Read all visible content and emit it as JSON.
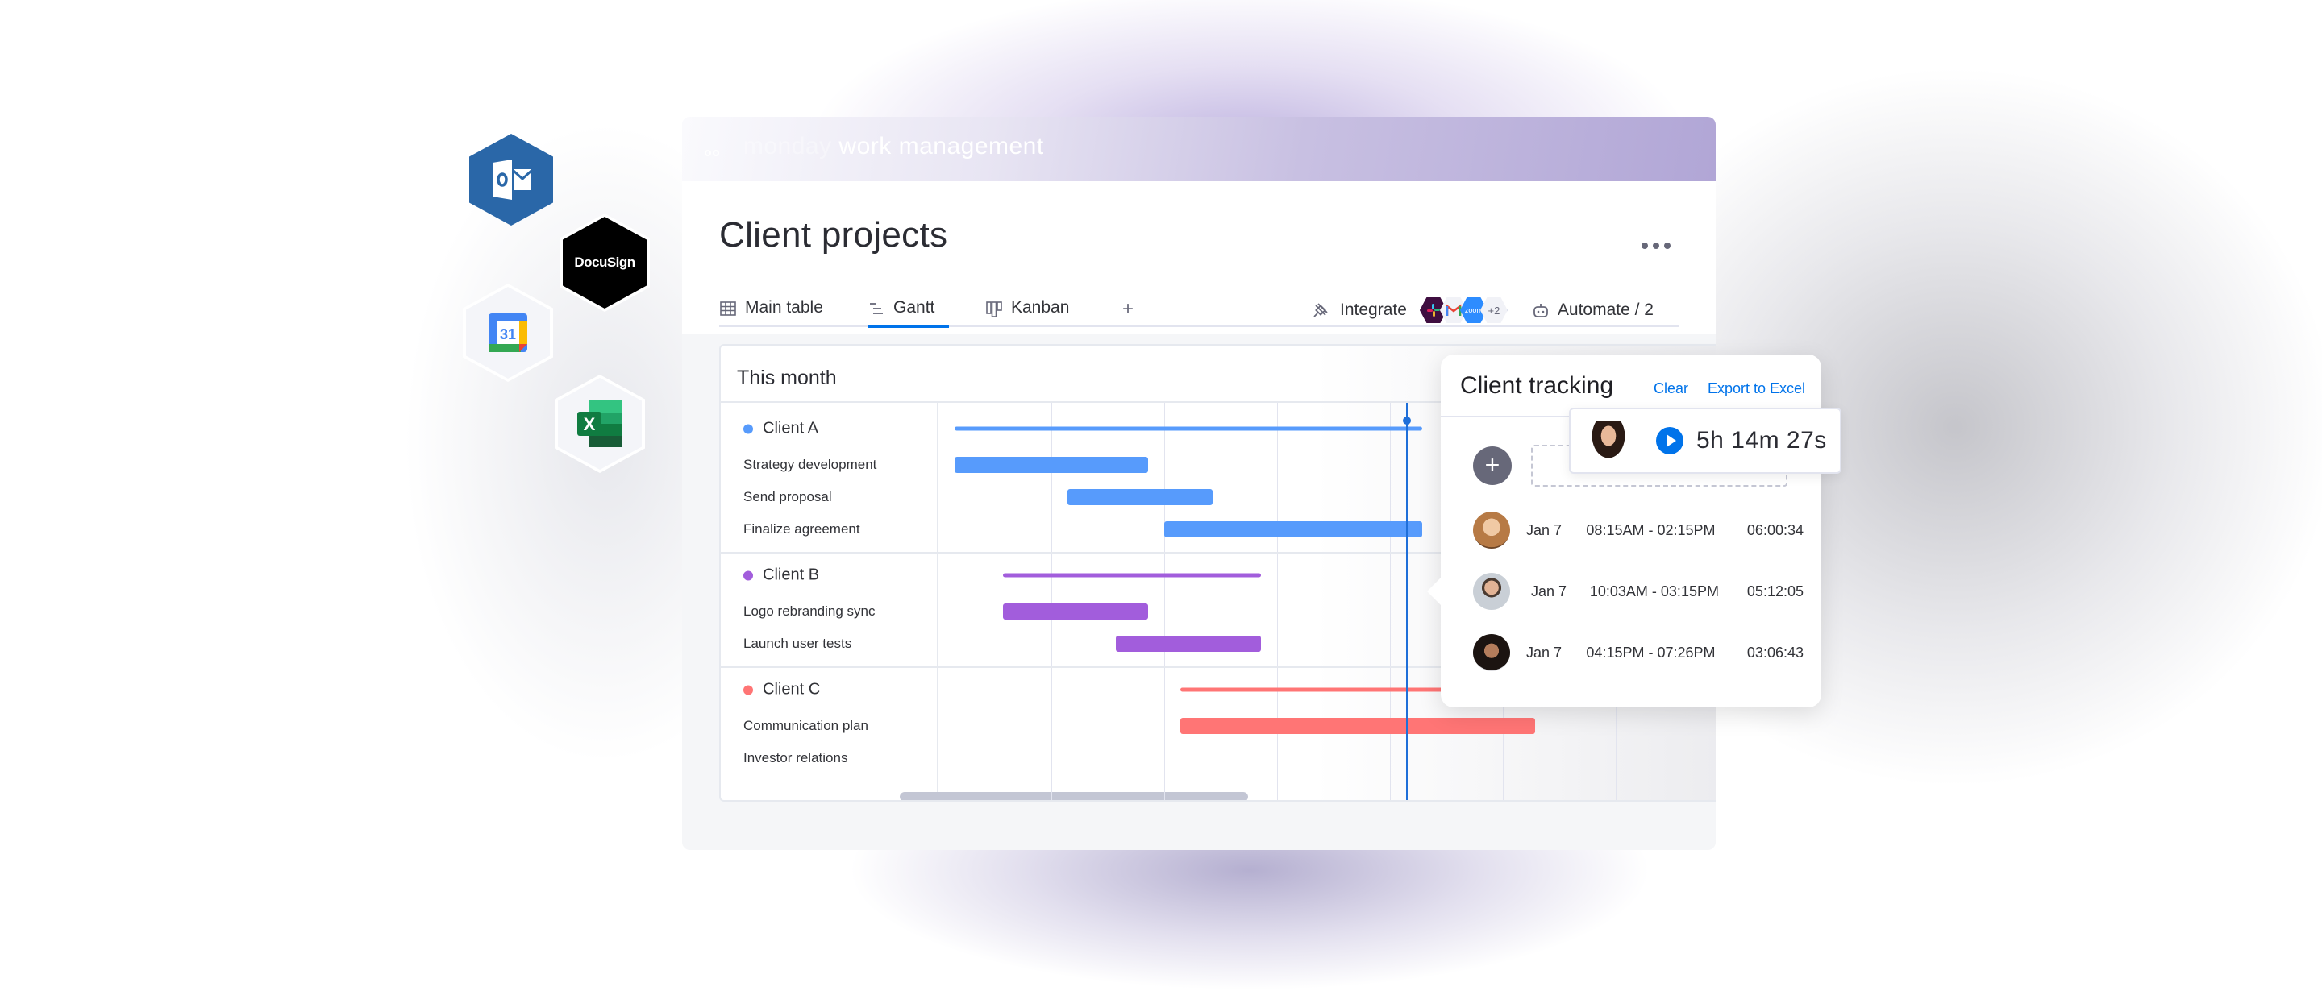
{
  "app": {
    "brand_prefix": "monday",
    "brand_suffix": "work management"
  },
  "board": {
    "title": "Client projects",
    "more_icon": "more-horizontal-icon"
  },
  "tabs": [
    {
      "label": "Main table",
      "icon": "table-icon",
      "active": false
    },
    {
      "label": "Gantt",
      "icon": "gantt-icon",
      "active": true
    },
    {
      "label": "Kanban",
      "icon": "kanban-icon",
      "active": false
    },
    {
      "label": "+",
      "icon": "add-icon",
      "active": false
    }
  ],
  "toolbar": {
    "integrate_label": "Integrate",
    "integrate_icon": "plug-icon",
    "integration_chips": [
      "slack",
      "gmail",
      "zoom"
    ],
    "zoom_chip_label": "zoom",
    "more_integrations": "+2",
    "automate_label": "Automate / 2",
    "automate_icon": "robot-icon"
  },
  "gantt": {
    "period_label": "This month",
    "today_day": 29,
    "days_per_column": 7,
    "groups": [
      {
        "name": "Client A",
        "color": "#579bfc",
        "span": [
          1,
          30
        ],
        "tasks": [
          {
            "name": "Strategy development",
            "start": 1,
            "end": 13
          },
          {
            "name": "Send proposal",
            "start": 8,
            "end": 17
          },
          {
            "name": "Finalize agreement",
            "start": 14,
            "end": 30
          }
        ]
      },
      {
        "name": "Client B",
        "color": "#a25ddc",
        "span": [
          4,
          20
        ],
        "tasks": [
          {
            "name": "Logo rebranding sync",
            "start": 4,
            "end": 13
          },
          {
            "name": "Launch user tests",
            "start": 11,
            "end": 20
          }
        ]
      },
      {
        "name": "Client C",
        "color": "#ff7575",
        "span": [
          15,
          37
        ],
        "tasks": [
          {
            "name": "Communication plan",
            "start": 15,
            "end": 37
          },
          {
            "name": "Investor relations",
            "start": null,
            "end": null
          }
        ]
      }
    ]
  },
  "tracking": {
    "title": "Client tracking",
    "clear_label": "Clear",
    "export_label": "Export to Excel",
    "active_timer": "5h 14m 27s",
    "entries": [
      {
        "date": "Jan 7",
        "range": "08:15AM - 02:15PM",
        "duration": "06:00:34"
      },
      {
        "date": "Jan 7",
        "range": "10:03AM - 03:15PM",
        "duration": "05:12:05"
      },
      {
        "date": "Jan 7",
        "range": "04:15PM - 07:26PM",
        "duration": "03:06:43"
      }
    ]
  },
  "integrations": {
    "outlook": "outlook-icon",
    "docusign_label": "DocuSign",
    "gcal_day": "31",
    "excel_letter": "X"
  }
}
